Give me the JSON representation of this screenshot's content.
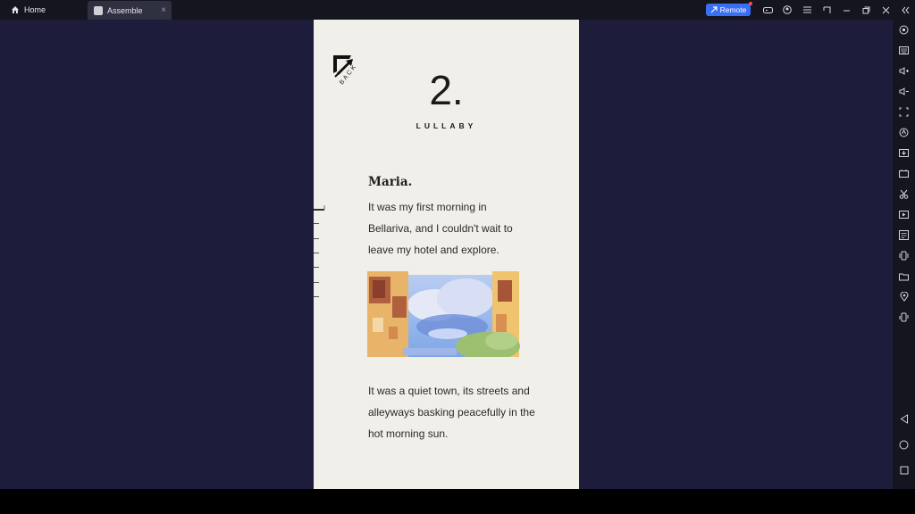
{
  "titlebar": {
    "home_tab": "Home",
    "app_tab": "Assemble",
    "close_glyph": "×",
    "remote_label": "Remote",
    "icons": [
      "gamepad-icon",
      "account-icon",
      "menu-icon",
      "window-icon",
      "minimize-icon",
      "restore-icon",
      "close-icon",
      "collapse-icon"
    ]
  },
  "sidebar": {
    "icons": [
      "record-icon",
      "keyboard-icon",
      "volume-up-icon",
      "volume-down-icon",
      "screenshot-icon",
      "sync-icon",
      "install-apk-icon",
      "fps-icon",
      "scissors-icon",
      "video-record-icon",
      "notes-icon",
      "shake-icon",
      "folder-icon",
      "location-icon",
      "rotate-icon",
      "back-icon",
      "home-icon",
      "recents-icon"
    ]
  },
  "phone": {
    "back_label": "BACK",
    "chapter_number": "2.",
    "chapter_title": "LULLABY",
    "speaker": "Maria.",
    "paragraph1": [
      "It was my first morning in",
      "Bellariva, and I couldn't wait to",
      "leave my hotel and explore."
    ],
    "paragraph2": [
      "It was a quiet town, its streets and",
      "alleyways basking peacefully in the",
      "hot morning sun."
    ],
    "scroll_tick_label": "I"
  }
}
